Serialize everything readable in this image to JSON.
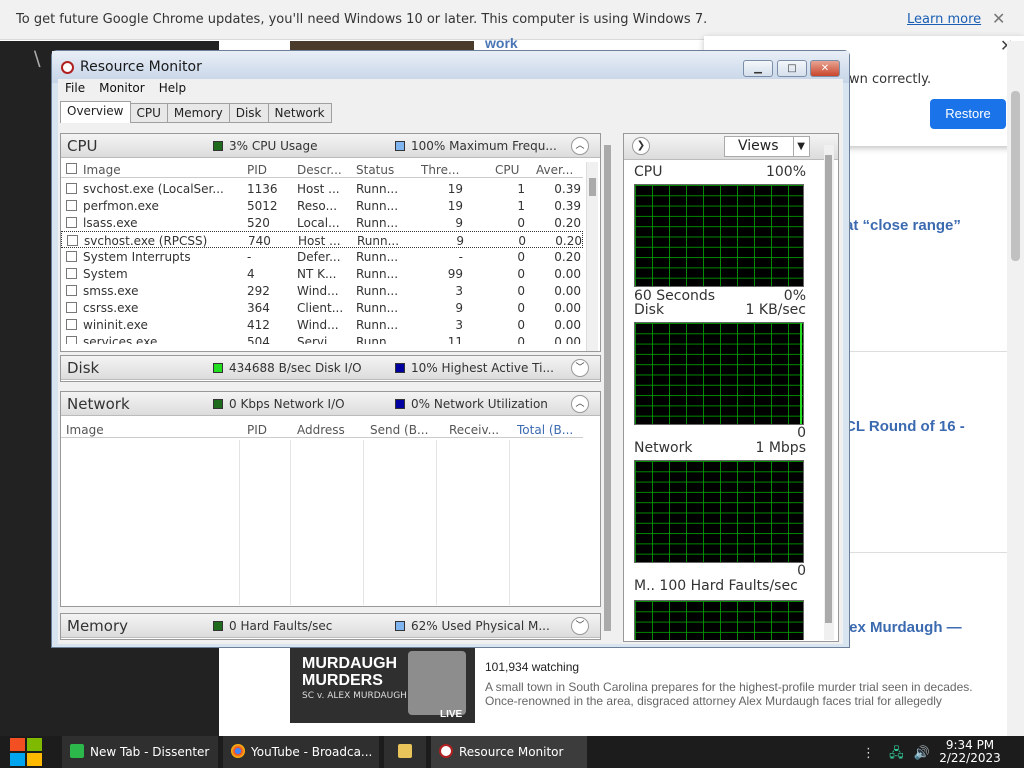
{
  "infobar": {
    "message": "To get future Google Chrome updates, you'll need Windows 10 or later. This computer is using Windows 7.",
    "learn_more": "Learn more",
    "close": "✕"
  },
  "bg": {
    "work_text": "work",
    "popup_text": "wn correctly.",
    "restore": "Restore",
    "headline1": "at “close range”",
    "headline2": "CL Round of 16 -",
    "headline3": "lex Murdaugh —",
    "thumb_title1": "MURDAUGH",
    "thumb_title2": "MURDERS",
    "thumb_sub": "SC v. ALEX MURDAUGH",
    "live": "LIVE",
    "watching": "101,934 watching",
    "desc1": "A small town in South Carolina prepares for the highest-profile murder trial seen in decades.",
    "desc2": "Once-renowned in the area, disgraced attorney Alex Murdaugh faces trial for allegedly"
  },
  "window": {
    "title": "Resource Monitor",
    "minimize": "▁",
    "maximize": "□",
    "close": "✕"
  },
  "menu": [
    "File",
    "Monitor",
    "Help"
  ],
  "tabs": [
    "Overview",
    "CPU",
    "Memory",
    "Disk",
    "Network"
  ],
  "cpu": {
    "title": "CPU",
    "stat1": "3% CPU Usage",
    "stat2": "100% Maximum Frequ...",
    "stat1_color": "#1e6b1e",
    "stat2_color": "#7fb6f0",
    "columns": [
      "Image",
      "PID",
      "Descr...",
      "Status",
      "Thre...",
      "CPU",
      "Aver..."
    ],
    "rows": [
      [
        "svchost.exe (LocalSer...",
        "1136",
        "Host ...",
        "Runn...",
        "19",
        "1",
        "0.39"
      ],
      [
        "perfmon.exe",
        "5012",
        "Reso...",
        "Runn...",
        "19",
        "1",
        "0.39"
      ],
      [
        "lsass.exe",
        "520",
        "Local...",
        "Runn...",
        "9",
        "0",
        "0.20"
      ],
      [
        "svchost.exe (RPCSS)",
        "740",
        "Host ...",
        "Runn...",
        "9",
        "0",
        "0.20"
      ],
      [
        "System Interrupts",
        "-",
        "Defer...",
        "Runn...",
        "-",
        "0",
        "0.20"
      ],
      [
        "System",
        "4",
        "NT K...",
        "Runn...",
        "99",
        "0",
        "0.00"
      ],
      [
        "smss.exe",
        "292",
        "Wind...",
        "Runn...",
        "3",
        "0",
        "0.00"
      ],
      [
        "csrss.exe",
        "364",
        "Client...",
        "Runn...",
        "9",
        "0",
        "0.00"
      ],
      [
        "wininit.exe",
        "412",
        "Wind...",
        "Runn...",
        "3",
        "0",
        "0.00"
      ],
      [
        "services.exe",
        "504",
        "Servi...",
        "Runn...",
        "11",
        "0",
        "0.00"
      ]
    ]
  },
  "disk": {
    "title": "Disk",
    "stat1": "434688 B/sec Disk I/O",
    "stat2": "10% Highest Active Ti...",
    "stat1_color": "#22dd22",
    "stat2_color": "#0000a0"
  },
  "network": {
    "title": "Network",
    "stat1": "0 Kbps Network I/O",
    "stat2": "0% Network Utilization",
    "stat1_color": "#1e6b1e",
    "stat2_color": "#0000a0",
    "columns": [
      "Image",
      "PID",
      "Address",
      "Send (B...",
      "Receiv...",
      "Total (B..."
    ]
  },
  "memory": {
    "title": "Memory",
    "stat1": "0 Hard Faults/sec",
    "stat2": "62% Used Physical M...",
    "stat1_color": "#1e6b1e",
    "stat2_color": "#7fb6f0"
  },
  "graphs": {
    "views": "Views",
    "cpu_label": "CPU",
    "cpu_max": "100%",
    "cpu_time": "60 Seconds",
    "cpu_min": "0%",
    "disk_label": "Disk",
    "disk_max": "1 KB/sec",
    "disk_min": "0",
    "net_label": "Network",
    "net_max": "1 Mbps",
    "net_min": "0",
    "mem_label": "M.. 100 Hard Faults/sec"
  },
  "taskbar": {
    "items": [
      "New Tab - Dissenter",
      "YouTube - Broadca...",
      "Resource Monitor"
    ],
    "time": "9:34 PM",
    "date": "2/22/2023"
  }
}
